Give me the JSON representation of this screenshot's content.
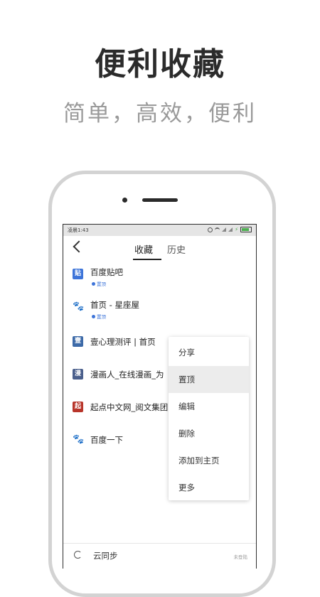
{
  "promo": {
    "headline": "便利收藏",
    "subline": "简单，高效，便利"
  },
  "statusbar": {
    "time": "凌晨1:43",
    "icons": [
      "alarm-icon",
      "wifi-icon",
      "signal-icon",
      "signal-icon",
      "charging-icon",
      "battery-icon"
    ]
  },
  "nav": {
    "back_icon": "back-arrow-icon",
    "tabs": [
      {
        "label": "收藏",
        "active": true
      },
      {
        "label": "历史",
        "active": false
      }
    ]
  },
  "bookmarks": [
    {
      "title": "百度贴吧",
      "icon_text": "贴",
      "icon": "tieba-icon",
      "pinned_label": "置顶"
    },
    {
      "title": "首页 - 星座屋",
      "icon": "baidu-paw-icon",
      "pinned_label": "置顶"
    },
    {
      "title": "壹心理测评 | 首页",
      "icon": "yixinli-icon"
    },
    {
      "title": "漫画人_在线漫画_为",
      "icon": "manhuaren-icon"
    },
    {
      "title": "起点中文网_阅文集团",
      "icon_text": "起",
      "icon": "qidian-icon"
    },
    {
      "title": "百度一下",
      "icon": "baidu-paw-icon"
    }
  ],
  "context_menu": {
    "items": [
      {
        "label": "分享"
      },
      {
        "label": "置顶",
        "highlighted": true
      },
      {
        "label": "编辑"
      },
      {
        "label": "删除"
      },
      {
        "label": "添加到主页"
      },
      {
        "label": "更多"
      }
    ]
  },
  "bottom": {
    "sync_label": "云同步",
    "login_status": "未登陆",
    "sync_icon": "refresh-icon"
  },
  "colors": {
    "accent": "#3d74d9",
    "menu_highlight": "#ececec",
    "phone_frame": "#d3d3d3"
  }
}
